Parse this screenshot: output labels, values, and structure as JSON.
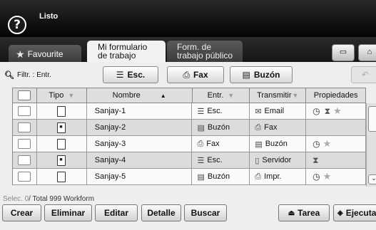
{
  "header": {
    "help_glyph": "?",
    "status": "Listo"
  },
  "tabs": {
    "favourite": "Favourite",
    "mi_formulario": [
      "Mi formulario",
      "de trabajo"
    ],
    "form_publico": [
      "Form. de",
      "trabajo público"
    ]
  },
  "filter": {
    "label": "Filtr. : Entr.",
    "buttons": [
      {
        "label": "Esc.",
        "icon": "scanner-icon"
      },
      {
        "label": "Fax",
        "icon": "fax-icon"
      },
      {
        "label": "Buzón",
        "icon": "mailbox-icon"
      }
    ]
  },
  "table": {
    "headers": {
      "tipo": "Tipo",
      "nombre": "Nombre",
      "entr": "Entr.",
      "transmitir": "Transmitir",
      "propiedades": "Propiedades"
    },
    "rows": [
      {
        "tipo": "document-icon",
        "nombre": "Sanjay-1",
        "entr": "Esc.",
        "transmitir": "Email",
        "props": [
          "clock",
          "hourglass",
          "star"
        ]
      },
      {
        "tipo": "locked-document-icon",
        "nombre": "Sanjay-2",
        "entr": "Buzón",
        "transmitir": "Fax",
        "props": []
      },
      {
        "tipo": "document-icon",
        "nombre": "Sanjay-3",
        "entr": "Fax",
        "transmitir": "Buzón",
        "props": [
          "clock",
          "star"
        ]
      },
      {
        "tipo": "locked-document-icon",
        "nombre": "Sanjay-4",
        "entr": "Esc.",
        "transmitir": "Servidor",
        "props": [
          "hourglass"
        ]
      },
      {
        "tipo": "document-icon",
        "nombre": "Sanjay-5",
        "entr": "Buzón",
        "transmitir": "Impr.",
        "props": [
          "clock",
          "star"
        ]
      }
    ]
  },
  "footer": {
    "selected": "Selec. 0",
    "total": "/ Total 999 Workform",
    "buttons": {
      "crear": "Crear",
      "eliminar": "Eliminar",
      "editar": "Editar",
      "detalle": "Detalle",
      "buscar": "Buscar",
      "tarea": "Tarea",
      "ejecutar": "Ejecuta"
    }
  }
}
